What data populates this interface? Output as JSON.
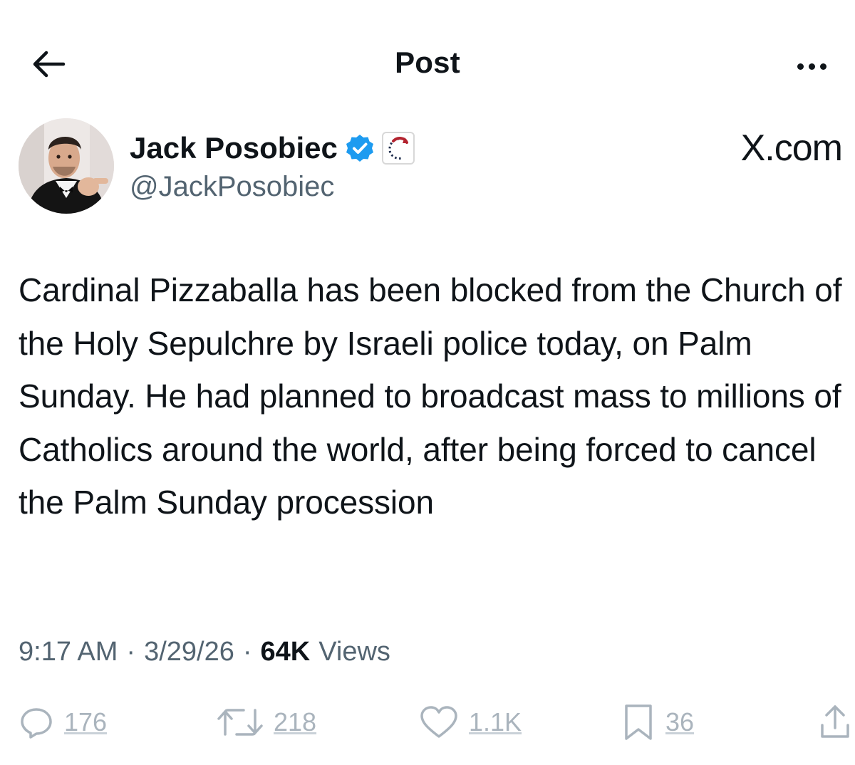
{
  "header": {
    "title": "Post",
    "back_icon": "arrow-left-icon",
    "more_icon": "more-horizontal-icon"
  },
  "author": {
    "name": "Jack Posobiec",
    "handle": "@JackPosobiec",
    "verified_icon": "verified-badge-icon",
    "affiliation_icon": "affiliation-badge-icon",
    "verified_color": "#1d9bf0"
  },
  "source_label": "X.com",
  "post": {
    "text": "Cardinal Pizzaballa has been blocked from the Church of the Holy Sepulchre by Israeli police today, on Palm Sunday. He had planned to broadcast mass to millions of Catholics around the world, after being forced to cancel the Palm Sunday procession"
  },
  "meta": {
    "time": "9:17 AM",
    "separator": "·",
    "date": "3/29/26",
    "views_count": "64K",
    "views_label": "Views"
  },
  "actions": {
    "reply_count": "176",
    "repost_count": "218",
    "like_count": "1.1K",
    "bookmark_count": "36"
  },
  "colors": {
    "text_primary": "#0f1419",
    "text_secondary": "#536471",
    "action_muted": "#aab4bd",
    "accent": "#1d9bf0"
  }
}
